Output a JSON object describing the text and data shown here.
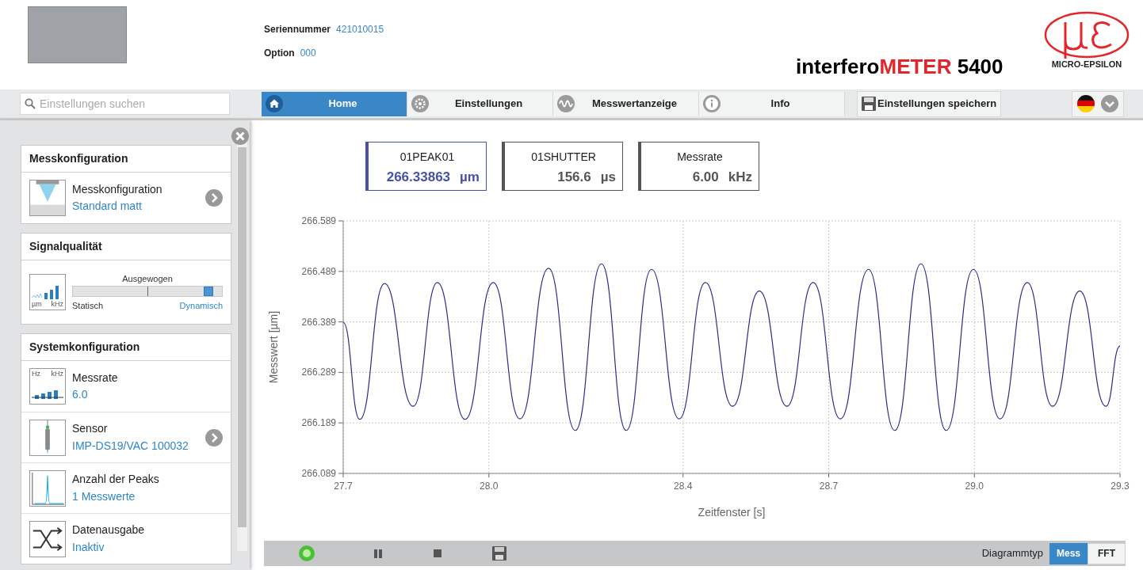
{
  "header": {
    "serial_label": "Seriennummer",
    "serial_value": "421010015",
    "option_label": "Option",
    "option_value": "000",
    "product_name": "interfero",
    "product_highlight": "METER",
    "product_model": "5400",
    "logo_text": "MICRO-EPSILON"
  },
  "search": {
    "placeholder": "Einstellungen suchen"
  },
  "tabs": [
    {
      "label": "Home",
      "kind": "home",
      "selected": true
    },
    {
      "label": "Einstellungen",
      "kind": "settings",
      "selected": false
    },
    {
      "label": "Messwertanzeige",
      "kind": "wave",
      "selected": false
    },
    {
      "label": "Info",
      "kind": "info",
      "selected": false
    }
  ],
  "save_button": "Einstellungen speichern",
  "sidebar": {
    "sections": [
      {
        "title": "Messkonfiguration",
        "items": [
          {
            "kind": "config",
            "label": "Messkonfiguration",
            "value": "Standard matt",
            "arrow": true
          }
        ]
      },
      {
        "title": "Signalqualität",
        "slider": {
          "icon_left": "µm",
          "icon_right": "kHz",
          "mid_label": "Ausgewogen",
          "min_label": "Statisch",
          "max_label": "Dynamisch",
          "level": 0.94
        }
      },
      {
        "title": "Systemkonfiguration",
        "items": [
          {
            "kind": "rate",
            "label": "Messrate",
            "value": "6.0",
            "arrow": false,
            "icon_left": "Hz",
            "icon_right": "kHz"
          },
          {
            "kind": "sensor",
            "label": "Sensor",
            "value": "IMP-DS19/VAC 100032",
            "arrow": true
          },
          {
            "kind": "peaks",
            "label": "Anzahl der Peaks",
            "value": "1 Messwerte",
            "arrow": false
          },
          {
            "kind": "output",
            "label": "Datenausgabe",
            "value": "Inaktiv",
            "arrow": false
          }
        ]
      }
    ]
  },
  "tiles": [
    {
      "title": "01PEAK01",
      "value": "266.33863",
      "unit": "µm",
      "selected": true
    },
    {
      "title": "01SHUTTER",
      "value": "156.6",
      "unit": "µs",
      "selected": false
    },
    {
      "title": "Messrate",
      "value": "6.00",
      "unit": "kHz",
      "selected": false
    }
  ],
  "chart": {
    "chart_data": {
      "type": "line",
      "xlabel": "Zeitfenster [s]",
      "ylabel": "Messwert [µm]",
      "x": [
        27.7,
        27.734,
        27.785,
        27.844,
        27.894,
        27.951,
        28.009,
        28.064,
        28.123,
        28.178,
        28.232,
        28.283,
        28.335,
        28.392,
        28.446,
        28.502,
        28.557,
        28.614,
        28.668,
        28.724,
        28.782,
        28.836,
        28.89,
        28.942,
        28.998,
        29.053,
        29.109,
        29.161,
        29.217,
        29.271,
        29.3
      ],
      "grid": true,
      "series": [
        {
          "color": "#2b2b8c",
          "values": [
            266.388,
            266.196,
            266.465,
            266.222,
            266.467,
            266.196,
            266.467,
            266.197,
            266.495,
            266.174,
            266.504,
            266.174,
            266.493,
            266.197,
            266.467,
            266.222,
            266.45,
            266.222,
            266.467,
            266.197,
            266.493,
            266.174,
            266.504,
            266.174,
            266.493,
            266.197,
            266.467,
            266.222,
            266.45,
            266.222,
            266.341
          ]
        }
      ],
      "xlim": [
        27.7,
        29.3
      ],
      "ylim": [
        266.089,
        266.589
      ],
      "xticks": [
        {
          "value": 27.7,
          "label": "27.7"
        },
        {
          "value": 28.0,
          "label": "28.0"
        },
        {
          "value": 28.4,
          "label": "28.4"
        },
        {
          "value": 28.7,
          "label": "28.7"
        },
        {
          "value": 29.0,
          "label": "29.0"
        },
        {
          "value": 29.3,
          "label": "29.3"
        }
      ],
      "yticks": [
        {
          "value": 266.089,
          "label": "266.089"
        },
        {
          "value": 266.189,
          "label": "266.189"
        },
        {
          "value": 266.289,
          "label": "266.289"
        },
        {
          "value": 266.389,
          "label": "266.389"
        },
        {
          "value": 266.489,
          "label": "266.489"
        },
        {
          "value": 266.589,
          "label": "266.589"
        }
      ]
    }
  },
  "bottom_bar": {
    "diagram_label": "Diagrammtyp",
    "diagram_types": [
      {
        "label": "Mess",
        "selected": true
      },
      {
        "label": "FFT",
        "selected": false
      }
    ]
  }
}
